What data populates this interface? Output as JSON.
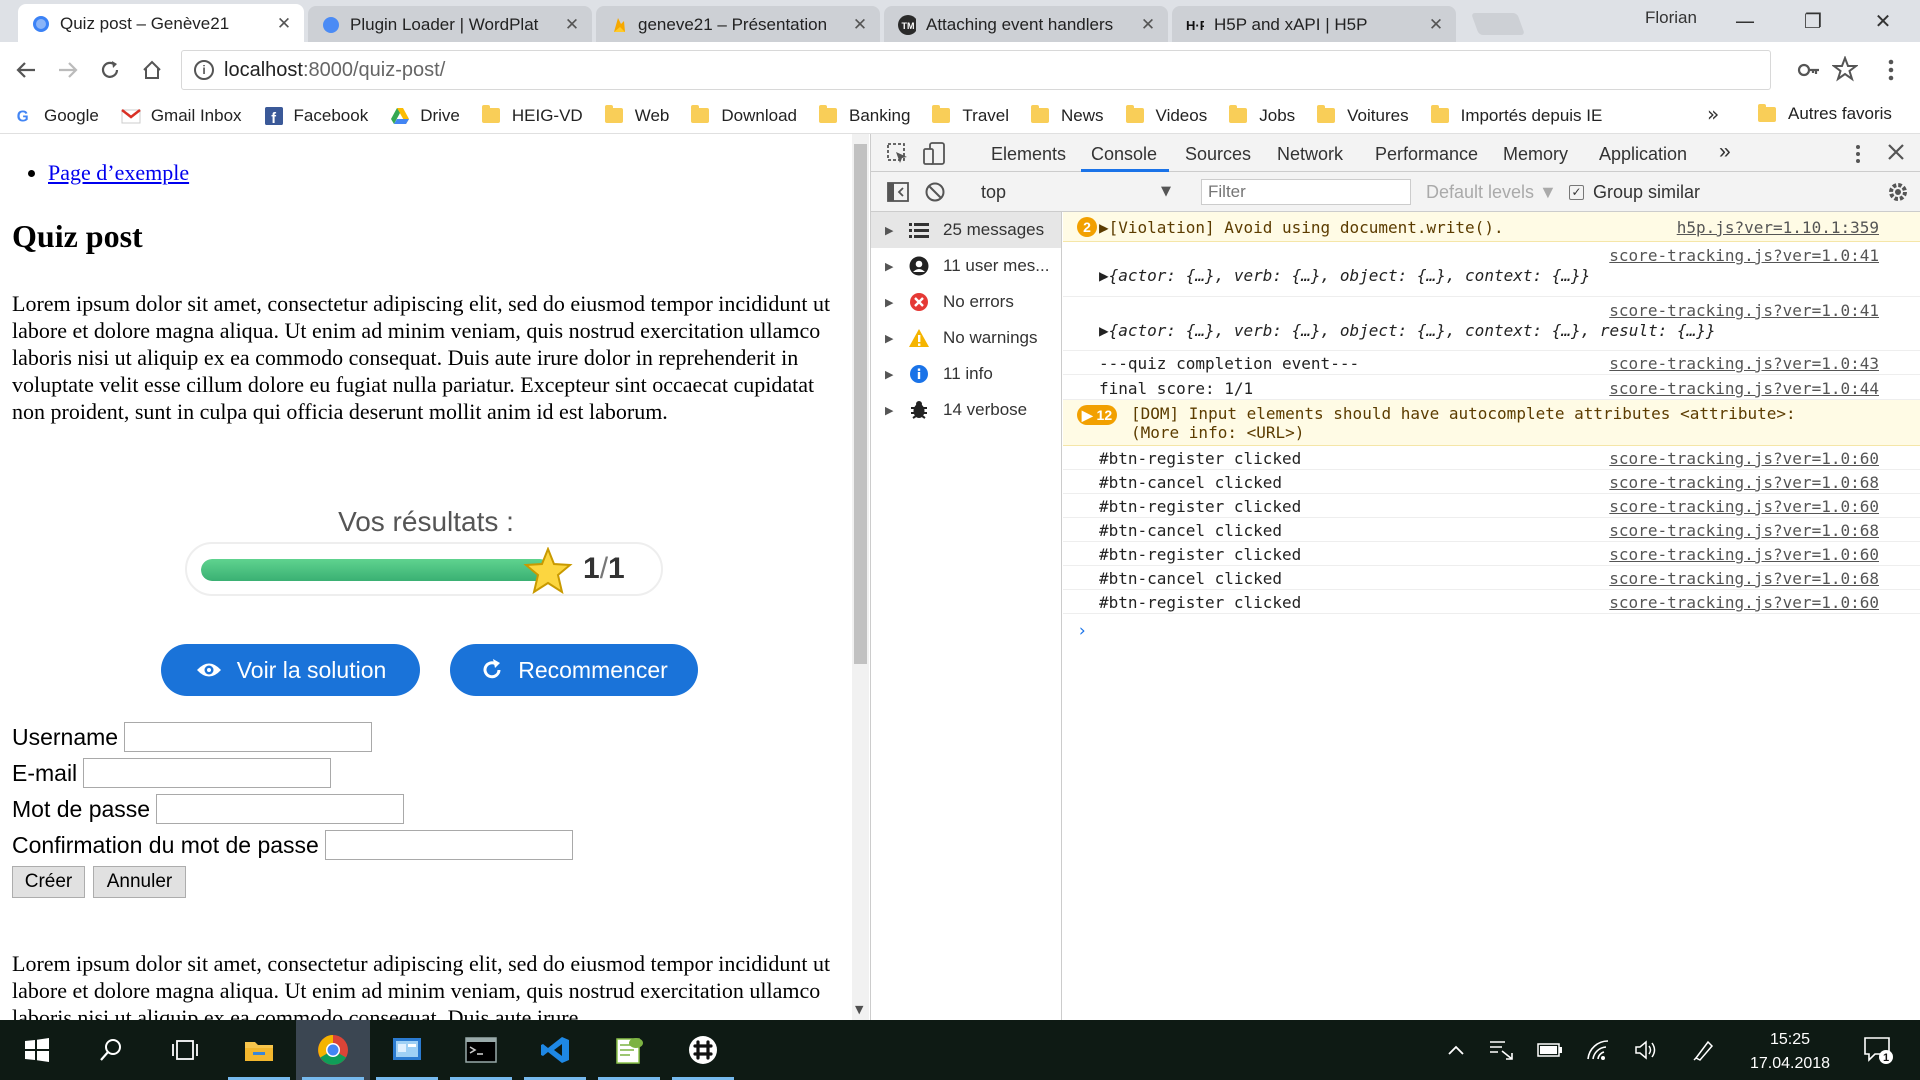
{
  "browser": {
    "tabs": [
      {
        "title": "Quiz post – Genève21",
        "favicon": "globe-blue"
      },
      {
        "title": "Plugin Loader | WordPlat",
        "favicon": "globe-blue"
      },
      {
        "title": "geneve21 – Présentation",
        "favicon": "firebase-flame"
      },
      {
        "title": "Attaching event handlers",
        "favicon": "tm-logo"
      },
      {
        "title": "H5P and xAPI | H5P",
        "favicon": "h5p-logo"
      }
    ],
    "close_glyph": "✕",
    "user": "Florian",
    "window_buttons": {
      "minimize": "—",
      "restore": "❐",
      "close": "✕"
    },
    "url": {
      "host": "localhost",
      "path": ":8000/quiz-post/"
    },
    "bookmarks": [
      {
        "label": "Google",
        "icon": "google-icon"
      },
      {
        "label": "Gmail Inbox",
        "icon": "gmail-icon"
      },
      {
        "label": "Facebook",
        "icon": "facebook-icon"
      },
      {
        "label": "Drive",
        "icon": "drive-icon"
      },
      {
        "label": "HEIG-VD",
        "icon": "folder-icon"
      },
      {
        "label": "Web",
        "icon": "folder-icon"
      },
      {
        "label": "Download",
        "icon": "folder-icon"
      },
      {
        "label": "Banking",
        "icon": "folder-icon"
      },
      {
        "label": "Travel",
        "icon": "folder-icon"
      },
      {
        "label": "News",
        "icon": "folder-icon"
      },
      {
        "label": "Videos",
        "icon": "folder-icon"
      },
      {
        "label": "Jobs",
        "icon": "folder-icon"
      },
      {
        "label": "Voitures",
        "icon": "folder-icon"
      },
      {
        "label": "Importés depuis IE",
        "icon": "folder-icon"
      }
    ],
    "bookmarks_more": "»",
    "other_bookmarks": "Autres favoris"
  },
  "page": {
    "nav_link": "Page d’exemple",
    "title": "Quiz post",
    "lorem_1": "Lorem ipsum dolor sit amet, consectetur adipiscing elit, sed do eiusmod tempor incididunt ut labore et dolore magna aliqua. Ut enim ad minim veniam, quis nostrud exercitation ullamco laboris nisi ut aliquip ex ea commodo consequat. Duis aute irure dolor in reprehenderit in voluptate velit esse cillum dolore eu fugiat nulla pariatur. Excepteur sint occaecat cupidatat non proident, sunt in culpa qui officia deserunt mollit anim id est laborum.",
    "lorem_2": "Lorem ipsum dolor sit amet, consectetur adipiscing elit, sed do eiusmod tempor incididunt ut labore et dolore magna aliqua. Ut enim ad minim veniam, quis nostrud exercitation ullamco laboris nisi ut aliquip ex ea commodo consequat. Duis aute irure",
    "results": {
      "heading": "Vos résultats :",
      "score": "1",
      "max": "1",
      "slash": "/",
      "progress_fraction": 1.0,
      "progress_color": "#4cc47f"
    },
    "buttons": {
      "solution": "Voir la solution",
      "retry": "Recommencer",
      "color": "#1a73d9"
    },
    "form": {
      "username": "Username",
      "email": "E-mail",
      "password": "Mot de passe",
      "confirm": "Confirmation du mot de passe",
      "create": "Créer",
      "cancel": "Annuler"
    }
  },
  "devtools": {
    "tabs": [
      "Elements",
      "Console",
      "Sources",
      "Network",
      "Performance",
      "Memory",
      "Application"
    ],
    "more_tabs": "»",
    "active_tab": "Console",
    "context": "top",
    "filter_placeholder": "Filter",
    "levels": "Default levels ▼",
    "group_similar": "Group similar",
    "sidebar": [
      {
        "label": "25 messages",
        "icon": "list-icon"
      },
      {
        "label": "11 user mes...",
        "icon": "user-icon"
      },
      {
        "label": "No errors",
        "icon": "error-icon"
      },
      {
        "label": "No warnings",
        "icon": "warning-icon"
      },
      {
        "label": "11 info",
        "icon": "info-icon"
      },
      {
        "label": "14 verbose",
        "icon": "bug-icon"
      }
    ],
    "messages": [
      {
        "count": "2",
        "text": "▶[Violation] Avoid using document.write().",
        "src": "h5p.js?ver=1.10.1:359",
        "kind": "warn"
      },
      {
        "text": "▶{actor: {…}, verb: {…}, object: {…}, context: {…}}",
        "src": "score-tracking.js?ver=1.0:41",
        "kind": "obj"
      },
      {
        "text": "▶{actor: {…}, verb: {…}, object: {…}, context: {…}, result: {…}}",
        "src": "score-tracking.js?ver=1.0:41",
        "kind": "obj"
      },
      {
        "text": "---quiz completion event---",
        "src": "score-tracking.js?ver=1.0:43",
        "kind": "log"
      },
      {
        "text": "final score: 1/1",
        "src": "score-tracking.js?ver=1.0:44",
        "kind": "log"
      },
      {
        "count": "12",
        "text": "[DOM] Input elements should have autocomplete attributes <attribute>:\n(More info: <URL>)",
        "src": "",
        "kind": "warn2"
      },
      {
        "text": "#btn-register clicked",
        "src": "score-tracking.js?ver=1.0:60",
        "kind": "log"
      },
      {
        "text": "#btn-cancel clicked",
        "src": "score-tracking.js?ver=1.0:68",
        "kind": "log"
      },
      {
        "text": "#btn-register clicked",
        "src": "score-tracking.js?ver=1.0:60",
        "kind": "log"
      },
      {
        "text": "#btn-cancel clicked",
        "src": "score-tracking.js?ver=1.0:68",
        "kind": "log"
      },
      {
        "text": "#btn-register clicked",
        "src": "score-tracking.js?ver=1.0:60",
        "kind": "log"
      },
      {
        "text": "#btn-cancel clicked",
        "src": "score-tracking.js?ver=1.0:68",
        "kind": "log"
      },
      {
        "text": "#btn-register clicked",
        "src": "score-tracking.js?ver=1.0:60",
        "kind": "log"
      }
    ],
    "prompt": "›"
  },
  "taskbar": {
    "apps": [
      "windows-start-icon",
      "search-icon",
      "task-view-icon",
      "file-explorer-icon",
      "chrome-icon",
      "control-panel-icon",
      "terminal-icon",
      "vscode-icon",
      "notepad-plus-icon",
      "slack-icon"
    ],
    "time": "15:25",
    "date": "17.04.2018",
    "notification_count": "1"
  }
}
